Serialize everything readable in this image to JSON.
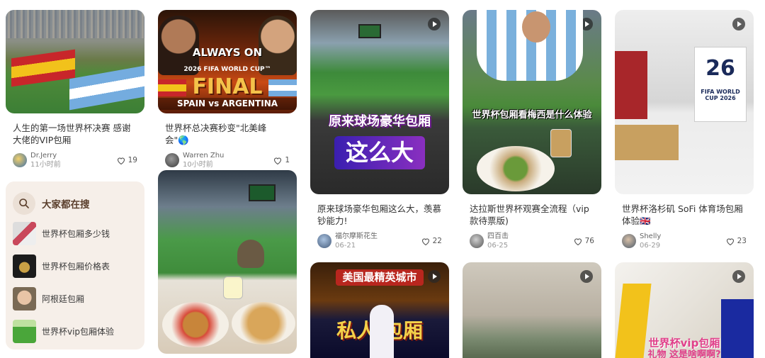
{
  "cards": [
    {
      "id": "c1",
      "title": "人生的第一场世界杯决赛 感谢大佬的VIP包厢",
      "author": "Dr.Jerry",
      "time": "11小时前",
      "likes": "19"
    },
    {
      "id": "c2",
      "title": "世界杯总决赛秒变\"北美峰会\"🌎",
      "author": "Warren Zhu",
      "time": "10小时前",
      "likes": "1",
      "overlay_brand": "ALWAYS ON",
      "overlay_event": "2026 FIFA WORLD CUP™",
      "overlay_final": "FINAL",
      "overlay_match": "SPAIN vs ARGENTINA"
    },
    {
      "id": "c3",
      "title": "",
      "author": "",
      "time": "",
      "likes": ""
    },
    {
      "id": "c4",
      "title": "原来球场豪华包厢这么大，羡慕钞能力!",
      "author": "福尔摩斯花生",
      "time": "06-21",
      "likes": "22",
      "overlay_line1": "原来球场豪华包厢",
      "overlay_line2": "这么大"
    },
    {
      "id": "c5",
      "title": "达拉斯世界杯观赛全流程（vip款待票版)",
      "author": "四百击",
      "time": "06-25",
      "likes": "76",
      "overlay_line1": "世界杯包厢看梅西是什么体验"
    },
    {
      "id": "c6",
      "title": "世界杯洛杉矶 SoFi 体育场包厢体验🇬🇧",
      "author": "Shelly",
      "time": "06-29",
      "likes": "23",
      "overlay_badge_num": "26",
      "overlay_badge_text": "FIFA WORLD CUP 2026"
    },
    {
      "id": "c7",
      "overlay_line1": "美国最精英城市",
      "overlay_line2": "私人 包厢"
    },
    {
      "id": "c8"
    },
    {
      "id": "c9",
      "overlay_line1": "世界杯vip包厢",
      "overlay_line2": "礼物 这是啥啊啊?"
    }
  ],
  "search": {
    "heading": "大家都在搜",
    "items": [
      "世界杯包厢多少钱",
      "世界杯包厢价格表",
      "阿根廷包厢",
      "世界杯vip包厢体验"
    ]
  },
  "colors": {
    "accent": "#5a3e2b",
    "panel": "#f6efe9"
  }
}
